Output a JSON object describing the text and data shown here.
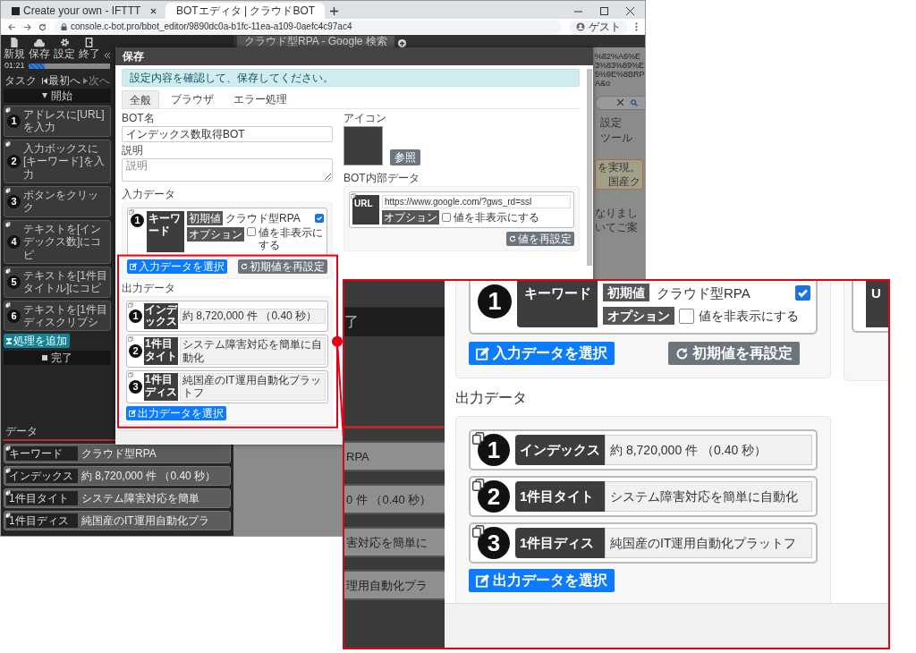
{
  "browser": {
    "tabs": [
      {
        "title": "Create your own - IFTTT",
        "selected": false
      },
      {
        "title": "BOTエディタ | クラウドBOT",
        "selected": true
      }
    ],
    "url": "console.c-bot.pro/bbot_editor/9890dc0a-b1fc-11ea-a109-0aefc4c97ac4",
    "profile": "ゲスト"
  },
  "editor": {
    "toolbar": [
      "新規",
      "保存",
      "設定",
      "終了"
    ],
    "timer": "01:21",
    "progress": {
      "level": 0.2
    },
    "task_header": "タスク",
    "first_button": "最初へ",
    "next_button": "次へ",
    "start_button": "開始",
    "tasks": [
      {
        "number": "1",
        "label": "アドレスに[URL]を入力"
      },
      {
        "number": "2",
        "label": "入力ボックスに[キーワード]を入力"
      },
      {
        "number": "3",
        "label": "ボタンをクリック"
      },
      {
        "number": "4",
        "label": "テキストを[インデックス数]にコピ"
      },
      {
        "number": "5",
        "label": "テキストを[1件目タイトル]にコピ"
      },
      {
        "number": "6",
        "label": "テキストを[1件目ディスクリプシ"
      }
    ],
    "add_button": "処理を追加",
    "finish_button": "完了",
    "data_header": "データ",
    "data_rows": [
      {
        "name": "キーワード",
        "value": "クラウド型RPA"
      },
      {
        "name": "インデックス",
        "value": "約 8,720,000 件 （0.40 秒）"
      },
      {
        "name": "1件目タイト",
        "value": "システム障害対応を簡単"
      },
      {
        "name": "1件目ディス",
        "value": "純国産のIT運用自動化プラ"
      }
    ]
  },
  "page_tab": "クラウド型RPA - Google 検索",
  "background_page": {
    "url_fragment": "%82%A6%E3%83%89%E5%9E%8BRPA&o",
    "menu": [
      "設定",
      "ツール"
    ],
    "snippet_lines": [
      "を実現。",
      "国産ク"
    ],
    "text_lines": [
      "なりまし",
      "いてご案"
    ]
  },
  "dialog": {
    "title": "保存",
    "notice": "設定内容を確認して、保存してください。",
    "tabs": [
      {
        "label": "全般",
        "selected": true
      },
      {
        "label": "ブラウザ",
        "selected": false
      },
      {
        "label": "エラー処理",
        "selected": false
      }
    ],
    "bot_name": {
      "label": "BOT名",
      "value": "インデックス数取得BOT"
    },
    "description": {
      "label": "説明",
      "placeholder": "説明"
    },
    "icon": {
      "label": "アイコン",
      "button": "参照"
    },
    "input_data": {
      "label": "入力データ",
      "items": [
        {
          "number": "1",
          "name": "キーワード",
          "default_label": "初期値",
          "default_value": "クラウド型RPA",
          "default_checked": true,
          "option_label": "オプション",
          "hide_label": "値を非表示にする",
          "hide_checked": false
        }
      ],
      "select_button": "入力データを選択",
      "reset_button": "初期値を再設定"
    },
    "internal_data": {
      "label": "BOT内部データ",
      "items": [
        {
          "name": "URL",
          "value": "https://www.google.com/?gws_rd=ssl",
          "option_label": "オプション",
          "hide_label": "値を非表示にする",
          "hide_checked": false
        }
      ],
      "reset_button": "値を再設定"
    },
    "output_data": {
      "label": "出力データ",
      "items": [
        {
          "number": "1",
          "name": "インデックス",
          "value": "約 8,720,000 件 （0.40 秒）"
        },
        {
          "number": "2",
          "name": "1件目タイト",
          "value": "システム障害対応を簡単に自動化"
        },
        {
          "number": "3",
          "name": "1件目ディス",
          "value": "純国産のIT運用自動化プラットフ"
        }
      ],
      "select_button": "出力データを選択"
    }
  },
  "callout": {
    "left_strip": {
      "finish_fragment": "了",
      "data_fragments": [
        "RPA",
        "0 件 （0.40 秒）",
        "害対応を簡単に",
        "理用自動化プラ"
      ]
    },
    "input_card": {
      "number": "1",
      "name": "キーワード",
      "default_label": "初期値",
      "default_value": "クラウド型RPA",
      "default_checked": true,
      "option_label": "オプション",
      "hide_label": "値を非表示にする",
      "hide_checked": false
    },
    "select_input_button": "入力データを選択",
    "reset_button": "初期値を再設定",
    "output_label": "出力データ",
    "outputs": [
      {
        "number": "1",
        "name": "インデックス",
        "value": "約 8,720,000 件 （0.40 秒）"
      },
      {
        "number": "2",
        "name": "1件目タイト",
        "value": "システム障害対応を簡単に自動化"
      },
      {
        "number": "3",
        "name": "1件目ディス",
        "value": "純国産のIT運用自動化プラットフ"
      }
    ],
    "select_output_button": "出力データを選択",
    "side_card_text": "U"
  }
}
